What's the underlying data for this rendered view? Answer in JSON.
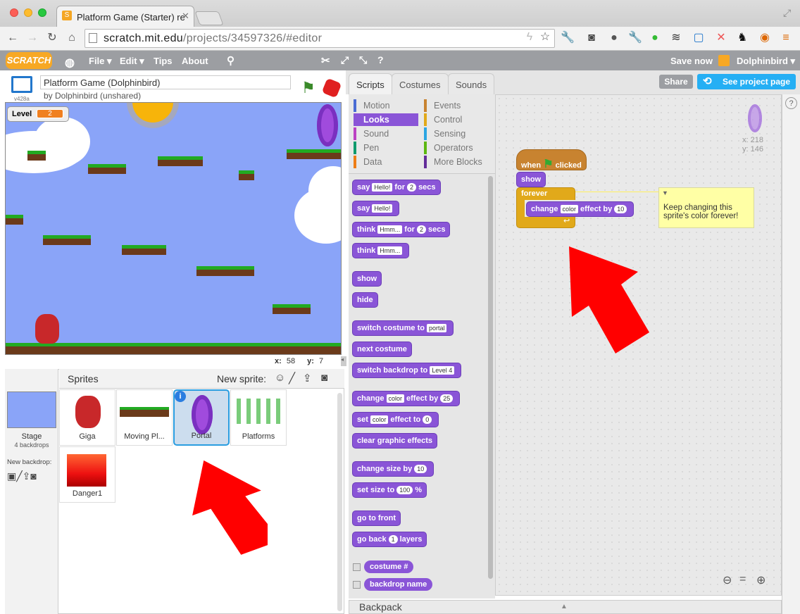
{
  "browser": {
    "tab_title": "Platform Game (Starter) re",
    "url_host": "scratch.mit.edu",
    "url_path": "/projects/34597326/#editor"
  },
  "menu": {
    "logo": "SCRATCH",
    "file": "File ▾",
    "edit": "Edit ▾",
    "tips": "Tips",
    "about": "About",
    "save_now": "Save now",
    "username": "Dolphinbird ▾"
  },
  "project": {
    "title": "Platform Game (Dolphinbird)",
    "byline": "by Dolphinbird (unshared)",
    "version": "v428a"
  },
  "stage": {
    "monitor_label": "Level",
    "monitor_value": "2",
    "x_label": "x:",
    "x_value": "58",
    "y_label": "y:",
    "y_value": "7"
  },
  "sprites_pane": {
    "header": "Sprites",
    "new_sprite": "New sprite:",
    "stage_label": "Stage",
    "stage_backdrops": "4 backdrops",
    "new_backdrop": "New backdrop:",
    "sprites": [
      {
        "name": "Giga"
      },
      {
        "name": "Moving Pl..."
      },
      {
        "name": "Portal"
      },
      {
        "name": "Platforms"
      },
      {
        "name": "Danger1"
      }
    ]
  },
  "editor_tabs": [
    "Scripts",
    "Costumes",
    "Sounds"
  ],
  "buttons": {
    "share": "Share",
    "see_project": "See project page"
  },
  "categories": [
    {
      "name": "Motion",
      "color": "#4a6cd4"
    },
    {
      "name": "Looks",
      "color": "#8a55d7"
    },
    {
      "name": "Sound",
      "color": "#bb42c3"
    },
    {
      "name": "Pen",
      "color": "#0e9a6c"
    },
    {
      "name": "Data",
      "color": "#ee7d16"
    },
    {
      "name": "Events",
      "color": "#c88330"
    },
    {
      "name": "Control",
      "color": "#e1a91a"
    },
    {
      "name": "Sensing",
      "color": "#2ca5e2"
    },
    {
      "name": "Operators",
      "color": "#5cb712"
    },
    {
      "name": "More Blocks",
      "color": "#632d99"
    }
  ],
  "palette": {
    "say_secs": {
      "a": "say",
      "slot": "Hello!",
      "b": "for",
      "num": "2",
      "c": "secs"
    },
    "say": {
      "a": "say",
      "slot": "Hello!"
    },
    "think_secs": {
      "a": "think",
      "slot": "Hmm...",
      "b": "for",
      "num": "2",
      "c": "secs"
    },
    "think": {
      "a": "think",
      "slot": "Hmm..."
    },
    "show": "show",
    "hide": "hide",
    "switch_costume": {
      "a": "switch costume to",
      "slot": "portal"
    },
    "next_costume": "next costume",
    "switch_backdrop": {
      "a": "switch backdrop to",
      "slot": "Level 4"
    },
    "change_effect": {
      "a": "change",
      "slot": "color",
      "b": "effect by",
      "num": "25"
    },
    "set_effect": {
      "a": "set",
      "slot": "color",
      "b": "effect to",
      "num": "0"
    },
    "clear_effects": "clear graphic effects",
    "change_size": {
      "a": "change size by",
      "num": "10"
    },
    "set_size": {
      "a": "set size to",
      "num": "100",
      "b": "%"
    },
    "go_front": "go to front",
    "go_back": {
      "a": "go back",
      "num": "1",
      "b": "layers"
    },
    "costume_num": "costume #",
    "backdrop_name": "backdrop name"
  },
  "script": {
    "hat_a": "when",
    "hat_b": "clicked",
    "show": "show",
    "forever": "forever",
    "change_a": "change",
    "change_slot": "color",
    "change_b": "effect by",
    "change_num": "10",
    "comment": "Keep changing this sprite's color forever!"
  },
  "sprite_info": {
    "x": "x: 218",
    "y": "y: 146"
  },
  "backpack": "Backpack"
}
